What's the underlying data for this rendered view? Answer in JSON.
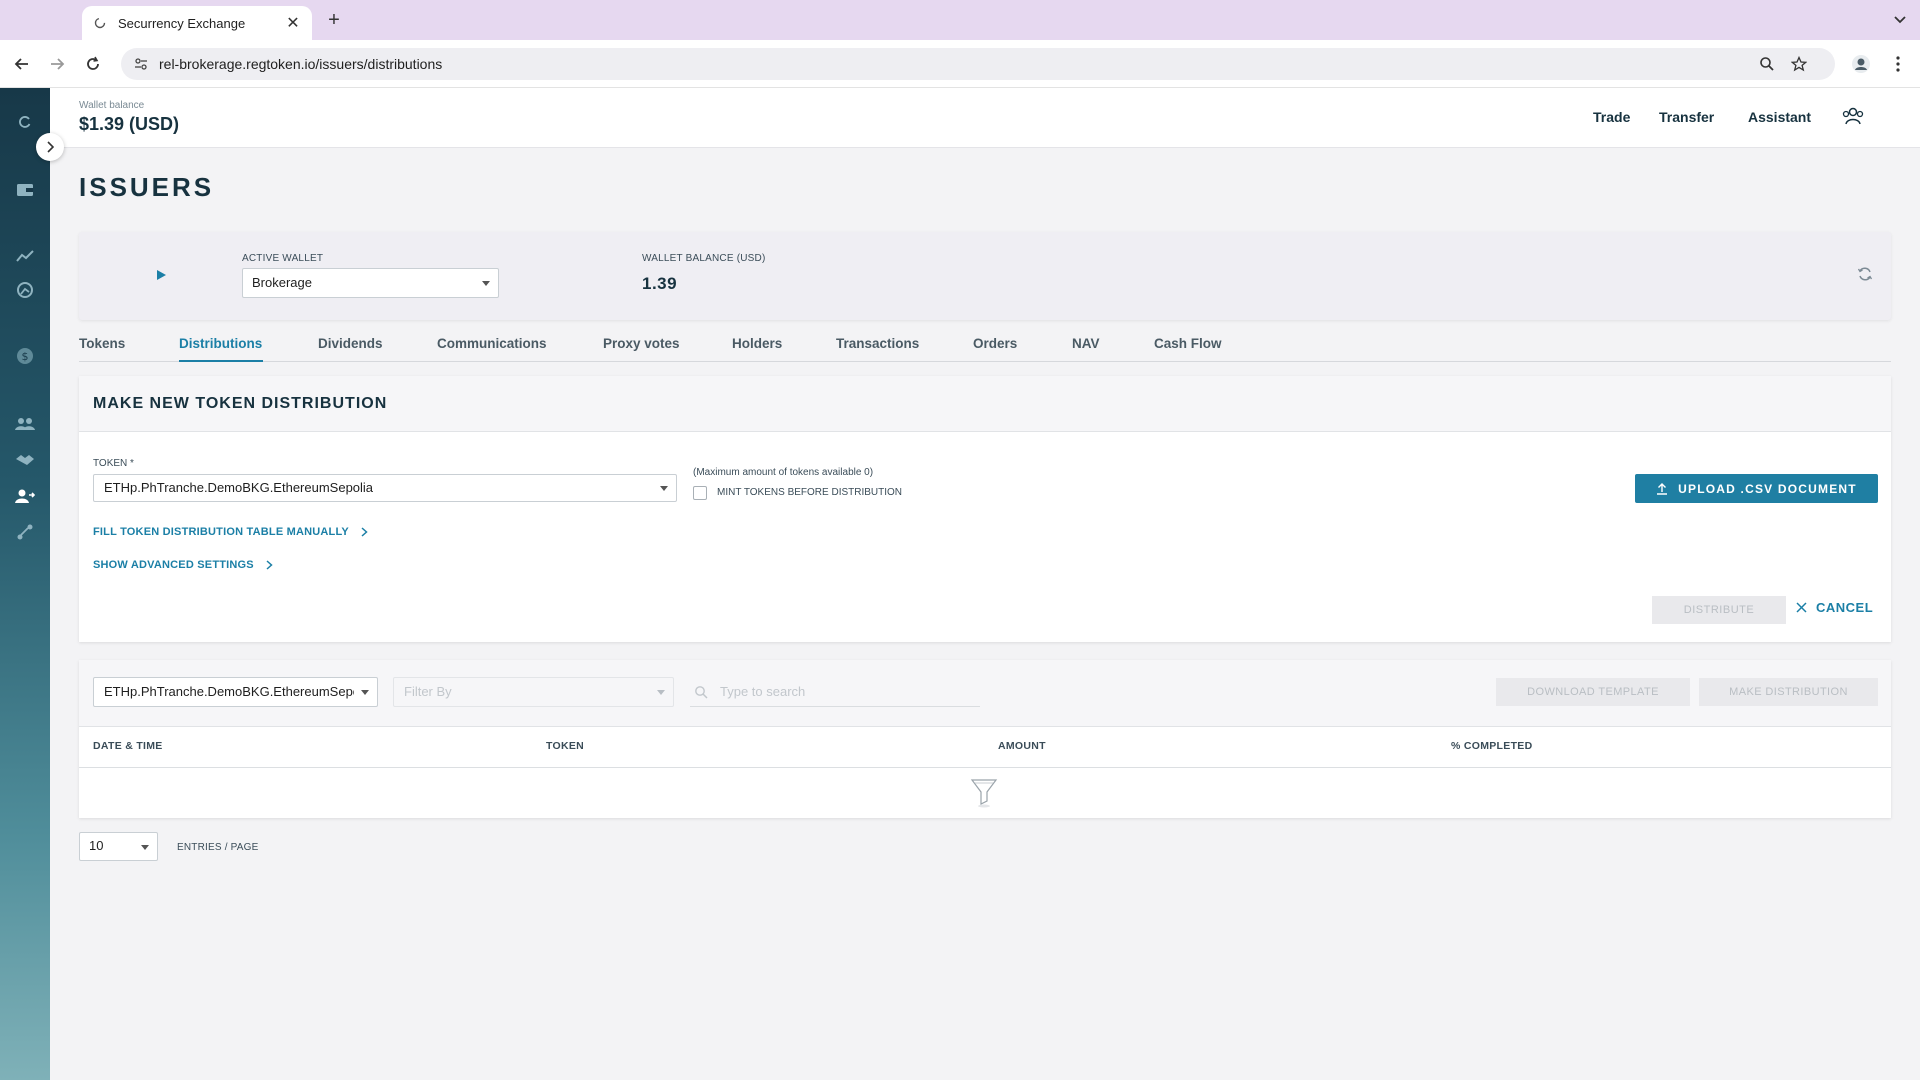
{
  "browser": {
    "tab_title": "Securrency Exchange",
    "url": "rel-brokerage.regtoken.io/issuers/distributions"
  },
  "header": {
    "wallet_balance_label": "Wallet balance",
    "wallet_balance_value": "$1.39 (USD)",
    "nav": [
      "Trade",
      "Transfer",
      "Assistant"
    ]
  },
  "page": {
    "title": "ISSUERS"
  },
  "wallet_card": {
    "active_wallet_label": "ACTIVE WALLET",
    "active_wallet_value": "Brokerage",
    "balance_label": "WALLET BALANCE (USD)",
    "balance_value": "1.39"
  },
  "tabs": [
    {
      "label": "Tokens",
      "active": false
    },
    {
      "label": "Distributions",
      "active": true
    },
    {
      "label": "Dividends",
      "active": false
    },
    {
      "label": "Communications",
      "active": false
    },
    {
      "label": "Proxy votes",
      "active": false
    },
    {
      "label": "Holders",
      "active": false
    },
    {
      "label": "Transactions",
      "active": false
    },
    {
      "label": "Orders",
      "active": false
    },
    {
      "label": "NAV",
      "active": false
    },
    {
      "label": "Cash Flow",
      "active": false
    }
  ],
  "distribution": {
    "title": "MAKE NEW TOKEN DISTRIBUTION",
    "token_label": "TOKEN *",
    "token_value": "ETHp.PhTranche.DemoBKG.EthereumSepolia",
    "max_note": "(Maximum amount of tokens available 0)",
    "mint_label": "MINT TOKENS BEFORE DISTRIBUTION",
    "mint_checked": false,
    "upload_label": "UPLOAD .CSV DOCUMENT",
    "fill_manually_label": "FILL TOKEN DISTRIBUTION TABLE MANUALLY",
    "advanced_label": "SHOW ADVANCED SETTINGS",
    "distribute_label": "DISTRIBUTE",
    "cancel_label": "CANCEL"
  },
  "table": {
    "token_filter_value": "ETHp.PhTranche.DemoBKG.EthereumSepolia",
    "filter_by_placeholder": "Filter By",
    "search_placeholder": "Type to search",
    "download_template_label": "DOWNLOAD TEMPLATE",
    "make_distribution_label": "MAKE DISTRIBUTION",
    "columns": [
      "DATE & TIME",
      "TOKEN",
      "AMOUNT",
      "% COMPLETED"
    ],
    "rows": []
  },
  "pagination": {
    "page_size": "10",
    "entries_label": "ENTRIES / PAGE"
  },
  "colors": {
    "accent": "#1b7fa6",
    "rail_top": "#173848",
    "rail_bottom": "#7fb1b8",
    "tab_strip": "#e6d8f0"
  }
}
